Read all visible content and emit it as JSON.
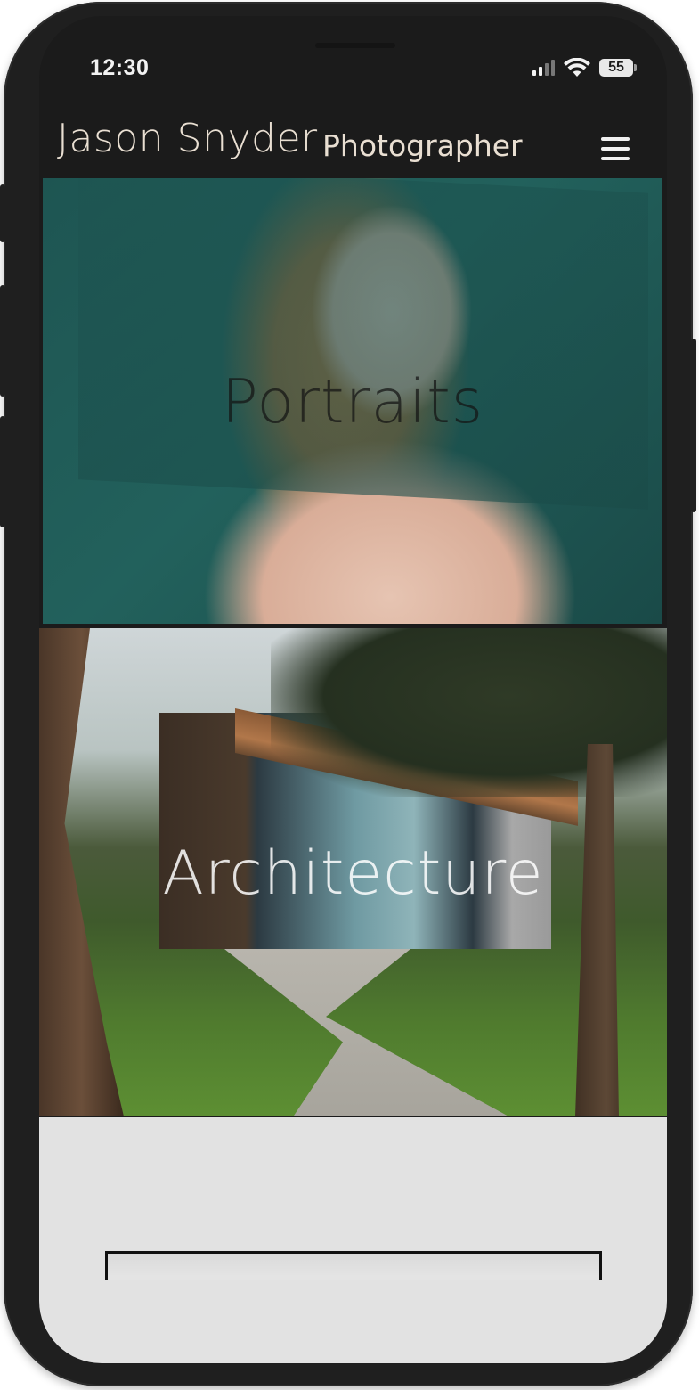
{
  "status_bar": {
    "time": "12:30",
    "battery": "55",
    "icons": [
      "signal-icon",
      "wifi-icon",
      "battery-icon"
    ]
  },
  "header": {
    "name": "Jason Snyder",
    "subtitle": "Photographer",
    "menu_icon": "hamburger-menu-icon"
  },
  "gallery": {
    "tiles": [
      {
        "label": "Portraits"
      },
      {
        "label": "Architecture"
      }
    ]
  },
  "colors": {
    "brand_text": "#e9dfd2",
    "screen_background": "#1b1b1b",
    "footer_background": "#e2e2e2"
  }
}
